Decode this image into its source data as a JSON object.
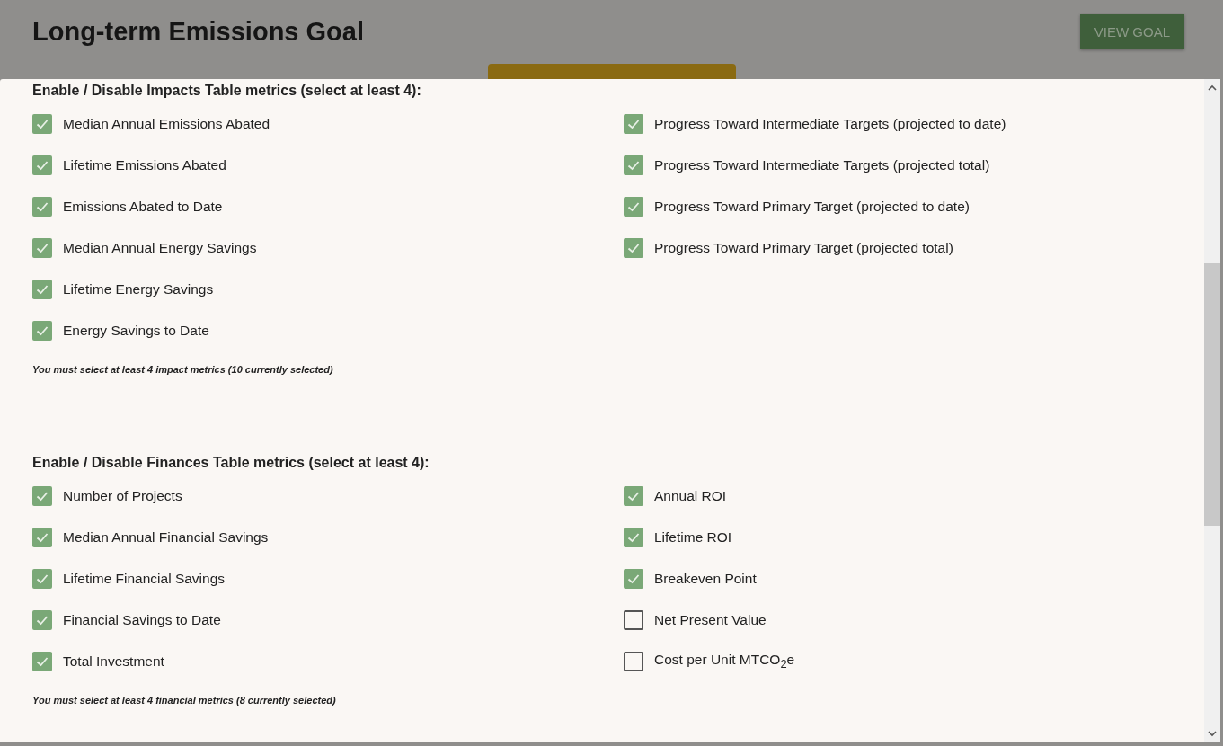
{
  "page": {
    "title": "Long-term Emissions Goal",
    "view_button": "VIEW GOAL"
  },
  "sections": [
    {
      "heading": "Enable / Disable Impacts Table metrics (select at least 4):",
      "columns": [
        [
          {
            "label": "Median Annual Emissions Abated",
            "checked": true
          },
          {
            "label": "Lifetime Emissions Abated",
            "checked": true
          },
          {
            "label": "Emissions Abated to Date",
            "checked": true
          },
          {
            "label": "Median Annual Energy Savings",
            "checked": true
          },
          {
            "label": "Lifetime Energy Savings",
            "checked": true
          },
          {
            "label": "Energy Savings to Date",
            "checked": true
          }
        ],
        [
          {
            "label": "Progress Toward Intermediate Targets (projected to date)",
            "checked": true
          },
          {
            "label": "Progress Toward Intermediate Targets (projected total)",
            "checked": true
          },
          {
            "label": "Progress Toward Primary Target (projected to date)",
            "checked": true
          },
          {
            "label": "Progress Toward Primary Target (projected total)",
            "checked": true
          }
        ]
      ],
      "note": "You must select at least 4 impact metrics (10 currently selected)"
    },
    {
      "heading": "Enable / Disable Finances Table metrics (select at least 4):",
      "columns": [
        [
          {
            "label": "Number of Projects",
            "checked": true
          },
          {
            "label": "Median Annual Financial Savings",
            "checked": true
          },
          {
            "label": "Lifetime Financial Savings",
            "checked": true
          },
          {
            "label": "Financial Savings to Date",
            "checked": true
          },
          {
            "label": "Total Investment",
            "checked": true
          }
        ],
        [
          {
            "label": "Annual ROI",
            "checked": true
          },
          {
            "label": "Lifetime ROI",
            "checked": true
          },
          {
            "label": "Breakeven Point",
            "checked": true
          },
          {
            "label": "Net Present Value",
            "checked": false
          },
          {
            "label": "Cost per Unit MTCO$_{2}$e",
            "checked": false
          }
        ]
      ],
      "note": "You must select at least 4 financial metrics (8 currently selected)"
    }
  ]
}
